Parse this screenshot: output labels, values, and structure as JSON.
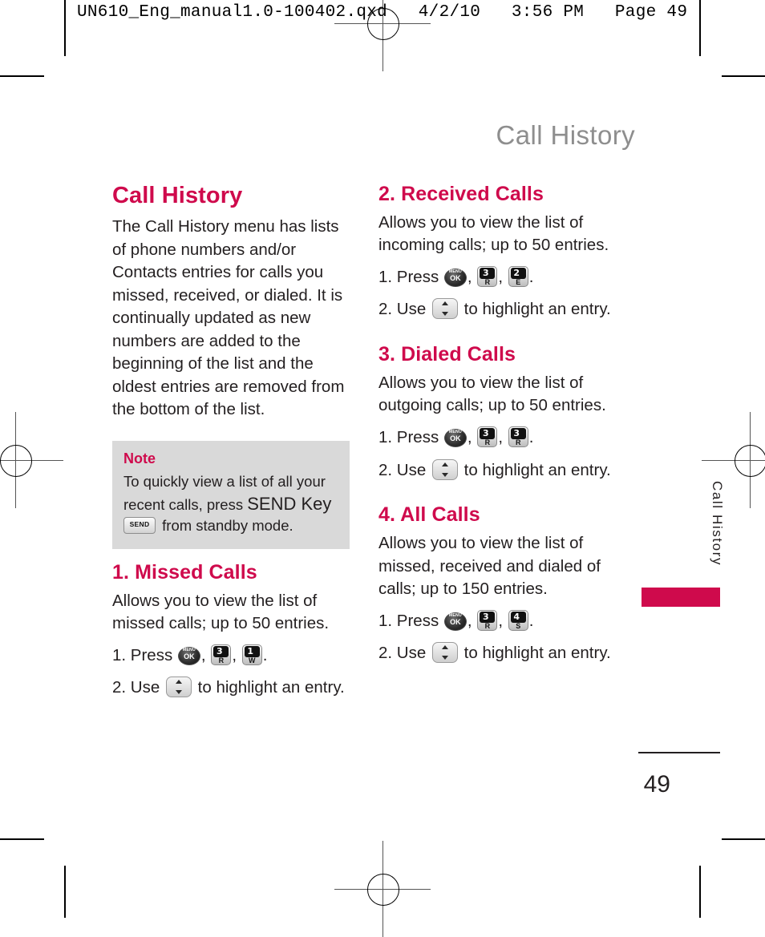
{
  "prepress": {
    "header_text": "UN610_Eng_manual1.0-100402.qxd   4/2/10   3:56 PM   Page 49"
  },
  "running_head": "Call History",
  "left_column": {
    "heading": "Call History",
    "intro": "The Call History menu has lists of phone numbers and/or Contacts entries for calls you missed, received, or dialed. It is continually updated as new numbers are added to the beginning of the list and the oldest entries are removed from the bottom of the list.",
    "note": {
      "label": "Note",
      "text_before_key": "To quickly view a list of all your recent calls, press ",
      "send_key_phrase": "SEND Key",
      "send_key_label": "SEND",
      "text_after_key": " from standby mode."
    },
    "section": {
      "heading": "1. Missed Calls",
      "description": "Allows you to view the list of missed calls; up to 50 entries.",
      "step1_prefix": "1. Press",
      "step1_keys": [
        {
          "type": "ok",
          "line1": "MENU",
          "line2": "OK"
        },
        {
          "type": "num",
          "digit": "3",
          "letter": "R"
        },
        {
          "type": "num",
          "digit": "1",
          "letter": "W"
        }
      ],
      "step2_prefix": "2. Use",
      "step2_suffix": "to highlight an entry."
    }
  },
  "right_column": {
    "sections": [
      {
        "heading": "2. Received Calls",
        "description": "Allows you to view the list of incoming calls; up to 50 entries.",
        "step1_prefix": "1. Press",
        "step1_keys": [
          {
            "type": "ok",
            "line1": "MENU",
            "line2": "OK"
          },
          {
            "type": "num",
            "digit": "3",
            "letter": "R"
          },
          {
            "type": "num",
            "digit": "2",
            "letter": "E"
          }
        ],
        "step2_prefix": "2. Use",
        "step2_suffix": "to highlight an entry."
      },
      {
        "heading": "3. Dialed Calls",
        "description": "Allows you to view the list of outgoing calls; up to 50 entries.",
        "step1_prefix": "1. Press",
        "step1_keys": [
          {
            "type": "ok",
            "line1": "MENU",
            "line2": "OK"
          },
          {
            "type": "num",
            "digit": "3",
            "letter": "R"
          },
          {
            "type": "num",
            "digit": "3",
            "letter": "R"
          }
        ],
        "step2_prefix": "2.  Use",
        "step2_suffix": "to highlight an entry."
      },
      {
        "heading": "4. All Calls",
        "description": "Allows you to view the list of missed, received and dialed of calls; up to 150 entries.",
        "step1_prefix": "1. Press",
        "step1_keys": [
          {
            "type": "ok",
            "line1": "MENU",
            "line2": "OK"
          },
          {
            "type": "num",
            "digit": "3",
            "letter": "R"
          },
          {
            "type": "num",
            "digit": "4",
            "letter": "S"
          }
        ],
        "step2_prefix": "2. Use",
        "step2_suffix": "to highlight an entry."
      }
    ]
  },
  "side_tab": "Call History",
  "page_number": "49",
  "colors": {
    "accent": "#cf0a4c",
    "running_head": "#8e8e8e",
    "note_bg": "#d9d9d9",
    "text": "#231f20"
  }
}
